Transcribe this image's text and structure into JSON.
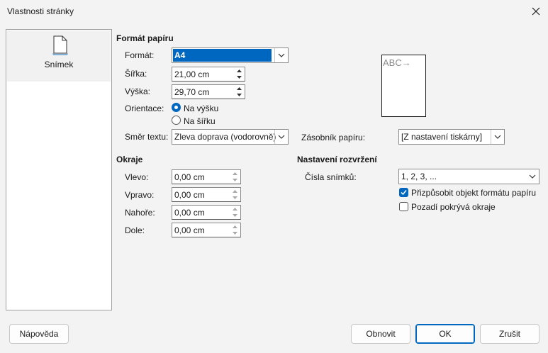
{
  "window": {
    "title": "Vlastnosti stránky"
  },
  "sidebar": {
    "items": [
      {
        "label": "Snímek",
        "icon": "page-icon"
      }
    ]
  },
  "paper_format": {
    "heading": "Formát papíru",
    "format_label": "Formát:",
    "format_value": "A4",
    "width_label": "Šířka:",
    "width_value": "21,00 cm",
    "height_label": "Výška:",
    "height_value": "29,70 cm",
    "orientation_label": "Orientace:",
    "portrait_label": "Na výšku",
    "landscape_label": "Na šířku",
    "orientation_selected": "portrait",
    "text_direction_label": "Směr textu:",
    "text_direction_value": "Zleva doprava (vodorovně)",
    "paper_tray_label": "Zásobník papíru:",
    "paper_tray_value": "[Z nastavení tiskárny]",
    "preview_text": "ABC→"
  },
  "margins": {
    "heading": "Okraje",
    "left_label": "Vlevo:",
    "left_value": "0,00 cm",
    "right_label": "Vpravo:",
    "right_value": "0,00 cm",
    "top_label": "Nahoře:",
    "top_value": "0,00 cm",
    "bottom_label": "Dole:",
    "bottom_value": "0,00 cm"
  },
  "layout_settings": {
    "heading": "Nastavení rozvržení",
    "slide_numbers_label": "Čísla snímků:",
    "slide_numbers_value": "1, 2, 3, ...",
    "fit_object_label": "Přizpůsobit objekt formátu papíru",
    "fit_object_checked": true,
    "background_covers_label": "Pozadí pokrývá okraje",
    "background_covers_checked": false
  },
  "buttons": {
    "help": "Nápověda",
    "reset": "Obnovit",
    "ok": "OK",
    "cancel": "Zrušit"
  },
  "colors": {
    "accent": "#0067c0",
    "background": "#f3f3f3"
  }
}
